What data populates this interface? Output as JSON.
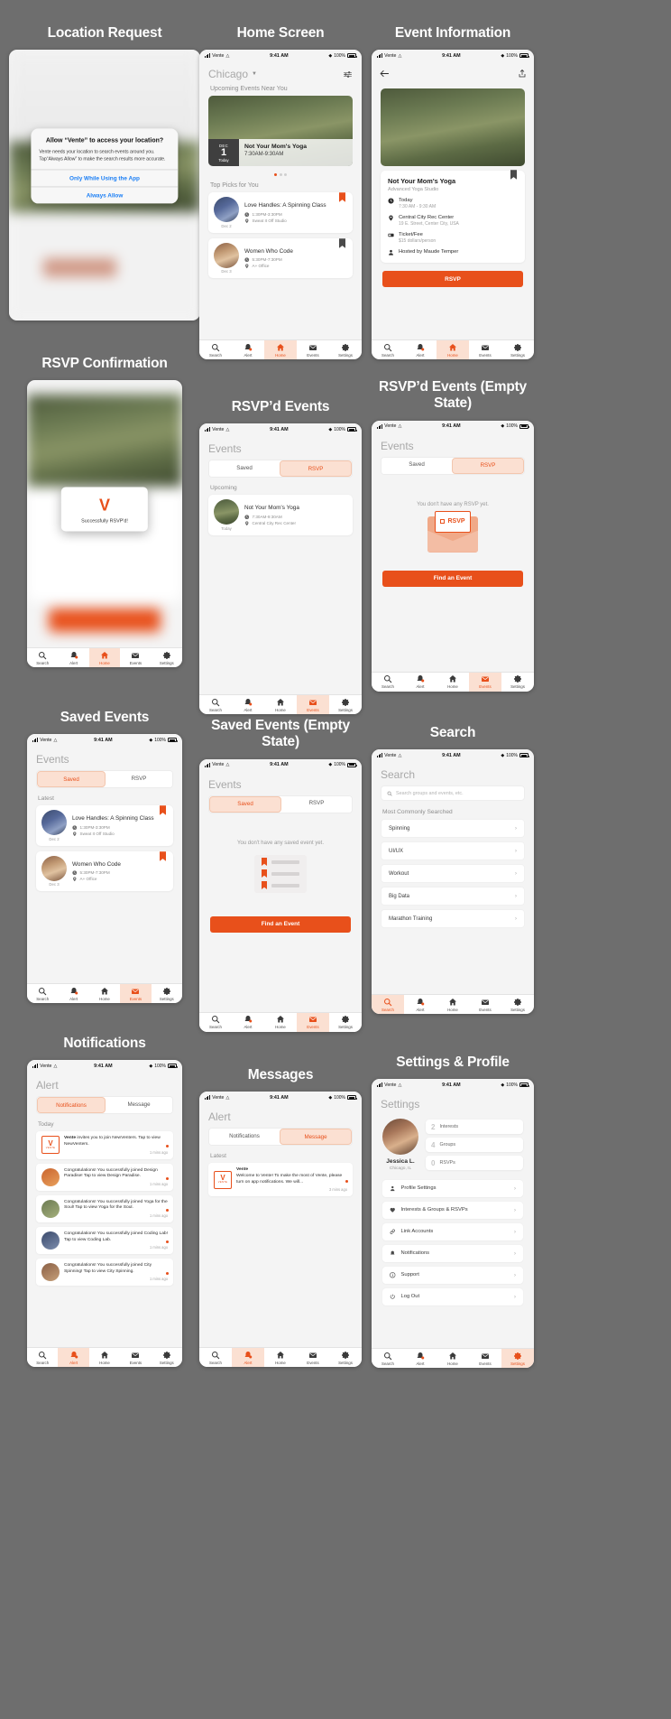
{
  "brand": {
    "accent": "#e8501b",
    "accent_light": "#fbe0d2",
    "blue": "#1a7ef5",
    "app_name": "Vente"
  },
  "status_bar": {
    "carrier": "Vente",
    "time": "9:41 AM",
    "battery": "100%"
  },
  "tabbar": {
    "items": [
      {
        "label": "Search",
        "icon": "search-icon"
      },
      {
        "label": "Alert",
        "icon": "bell-icon"
      },
      {
        "label": "Home",
        "icon": "home-icon"
      },
      {
        "label": "Events",
        "icon": "envelope-icon"
      },
      {
        "label": "Settings",
        "icon": "gear-icon"
      }
    ]
  },
  "screens": [
    {
      "id": "location-request",
      "caption": "Location Request",
      "dialog": {
        "title": "Allow “Vente” to access your location?",
        "message": "Vente needs your location to search events around you. Tap“Always Allow” to make the search results more accurate.",
        "buttons": [
          "Only While Using the App",
          "Always Allow"
        ]
      }
    },
    {
      "id": "home-screen",
      "caption": "Home Screen",
      "city": "Chicago",
      "section_upcoming": "Upcoming Events Near You",
      "hero": {
        "month": "DEC",
        "day": "1",
        "today": "Today",
        "title": "Not Your Mom's Yoga",
        "time": "7:30AM-9:30AM"
      },
      "carousel": {
        "count": 3,
        "active": 0
      },
      "section_top_picks": "Top Picks for You",
      "cards": [
        {
          "title": "Love Handles: A Spinning Class",
          "date": "Dec 2",
          "time": "1:30PM-3:30PM",
          "place": "Sweat It Off Studio",
          "bookmarked": true
        },
        {
          "title": "Women Who Code",
          "date": "Dec 3",
          "time": "5:30PM-7:30PM",
          "place": "A+ Office",
          "bookmarked": true
        }
      ],
      "active_tab": "Home"
    },
    {
      "id": "event-information",
      "caption": "Event Information",
      "title": "Not Your Mom's Yoga",
      "subtitle": "Advanced Yoga Studio",
      "details": [
        {
          "icon": "clock-icon",
          "key": "Today",
          "value": "7:30 AM - 9:30 AM"
        },
        {
          "icon": "pin-icon",
          "key": "Central City Rec Center",
          "value": "19 E. Street, Center City, USA"
        },
        {
          "icon": "ticket-icon",
          "key": "Ticket/Fee",
          "value": "$15 dollars/person"
        },
        {
          "icon": "person-icon",
          "key": "Hosted by Maude Temper",
          "value": ""
        }
      ],
      "rsvp_button": "RSVP",
      "active_tab": "Home"
    },
    {
      "id": "rsvp-confirmation",
      "caption": "RSVP Confirmation",
      "toast": {
        "logo": "V",
        "text": "Successfully RSVP'd!"
      },
      "active_tab": "Home"
    },
    {
      "id": "rsvpd-events",
      "caption": "RSVP’d Events",
      "title": "Events",
      "tabs": [
        "Saved",
        "RSVP"
      ],
      "active_segment": "RSVP",
      "section": "Upcoming",
      "cards": [
        {
          "title": "Not Your Mom's Yoga",
          "date": "Today",
          "time": "7:30AM-9:30AM",
          "place": "Central City Rec Center"
        }
      ],
      "active_tab": "Events"
    },
    {
      "id": "rsvpd-events-empty",
      "caption": "RSVP’d Events (Empty State)",
      "title": "Events",
      "tabs": [
        "Saved",
        "RSVP"
      ],
      "active_segment": "RSVP",
      "empty_text": "You don't have any RSVP yet.",
      "illustration_label": "RSVP",
      "button": "Find an Event",
      "active_tab": "Events"
    },
    {
      "id": "saved-events",
      "caption": "Saved Events",
      "title": "Events",
      "tabs": [
        "Saved",
        "RSVP"
      ],
      "active_segment": "Saved",
      "section": "Latest",
      "cards": [
        {
          "title": "Love Handles: A Spinning Class",
          "date": "Dec 2",
          "time": "1:30PM-3:30PM",
          "place": "Sweat It Off Studio",
          "bookmarked": true
        },
        {
          "title": "Women Who Code",
          "date": "Dec 3",
          "time": "5:30PM-7:30PM",
          "place": "A+ Office",
          "bookmarked": true
        }
      ],
      "active_tab": "Events"
    },
    {
      "id": "saved-events-empty",
      "caption": "Saved Events (Empty State)",
      "title": "Events",
      "tabs": [
        "Saved",
        "RSVP"
      ],
      "active_segment": "Saved",
      "empty_text": "You don't have any saved event yet.",
      "button": "Find an Event",
      "active_tab": "Events"
    },
    {
      "id": "search",
      "caption": "Search",
      "title": "Search",
      "search_placeholder": "Search groups and events, etc.",
      "section": "Most Commonly Searched",
      "items": [
        "Spinning",
        "UI/UX",
        "Workout",
        "Big Data",
        "Marathon Training"
      ],
      "active_tab": "Search"
    },
    {
      "id": "notifications",
      "caption": "Notifications",
      "title": "Alert",
      "tabs": [
        "Notifications",
        "Message"
      ],
      "active_segment": "Notifications",
      "section": "Today",
      "items": [
        {
          "avatar": "vente-logo",
          "text_bold": "Vente",
          "text": " invites you to join NewVenters. Tap to view NewVenters.",
          "time": "1 mins ago",
          "unread": true
        },
        {
          "avatar": "photo-yoga",
          "text_bold": "",
          "text": "Congratulations! You successfully joined Design Paradise! Tap to view Design Paradise.",
          "time": "1 mins ago",
          "unread": true
        },
        {
          "avatar": "photo-spin",
          "text_bold": "",
          "text": "Congratulations! You successfully joined Yoga for the Soul! Tap to view Yoga for the Soul.",
          "time": "1 mins ago",
          "unread": true
        },
        {
          "avatar": "photo-code",
          "text_bold": "",
          "text": "Congratulations! You successfully joined Coding Lab! Tap to view Coding Lab.",
          "time": "1 mins ago",
          "unread": true
        },
        {
          "avatar": "photo-city",
          "text_bold": "",
          "text": "Congratulations! You successfully joined City Spinning! Tap to view City Spinning.",
          "time": "1 mins ago",
          "unread": true
        }
      ],
      "active_tab": "Alert"
    },
    {
      "id": "messages",
      "caption": "Messages",
      "title": "Alert",
      "tabs": [
        "Notifications",
        "Message"
      ],
      "active_segment": "Message",
      "section": "Latest",
      "items": [
        {
          "avatar": "vente-logo",
          "text_bold": "Vente",
          "text": "Welcome to Vente! To make the most of Vente, please turn on app notifications. We will...",
          "time": "3 mins ago",
          "unread": true
        }
      ],
      "active_tab": "Alert"
    },
    {
      "id": "settings-profile",
      "caption": "Settings & Profile",
      "title": "Settings",
      "profile": {
        "name": "Jessica L.",
        "location": "Chicago, IL"
      },
      "stats": [
        {
          "value": "2",
          "label": "Interests"
        },
        {
          "value": "4",
          "label": "Groups"
        },
        {
          "value": "0",
          "label": "RSVPs"
        }
      ],
      "rows": [
        {
          "icon": "person-icon",
          "label": "Profile Settings"
        },
        {
          "icon": "heart-icon",
          "label": "Interests & Groups & RSVPs"
        },
        {
          "icon": "link-icon",
          "label": "Link Accounts"
        },
        {
          "icon": "bell-icon",
          "label": "Notifications"
        },
        {
          "icon": "info-icon",
          "label": "Support"
        },
        {
          "icon": "power-icon",
          "label": "Log Out"
        }
      ],
      "active_tab": "Settings"
    }
  ]
}
